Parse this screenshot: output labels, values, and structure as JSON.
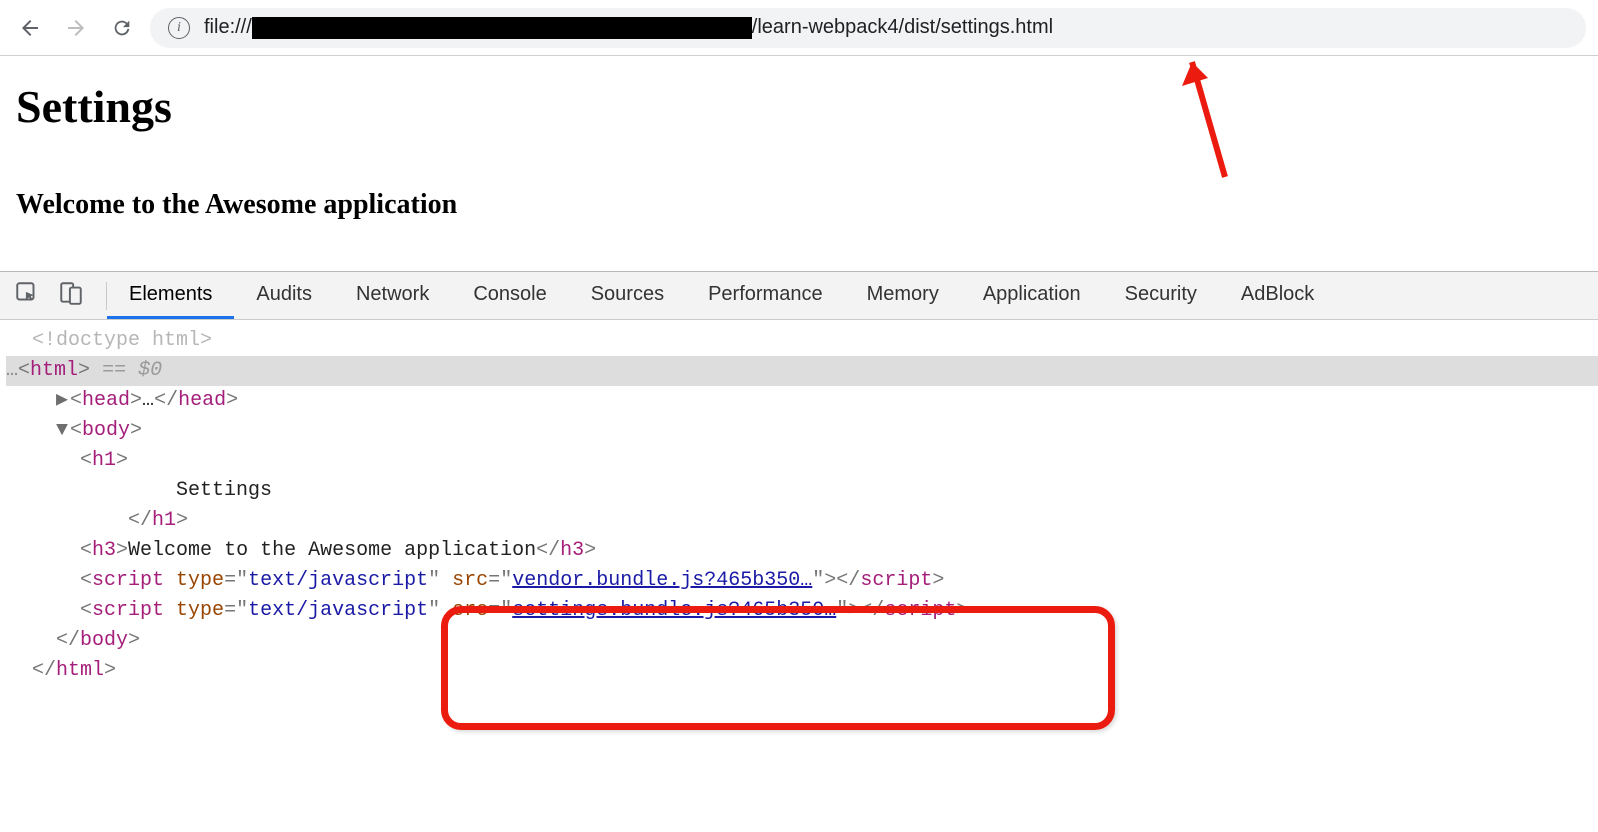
{
  "toolbar": {
    "url_prefix": "file:///",
    "url_suffix": "/learn-webpack4/dist/settings.html"
  },
  "page": {
    "heading": "Settings",
    "subheading": "Welcome to the Awesome application"
  },
  "devtools": {
    "tabs": [
      {
        "label": "Elements",
        "active": true
      },
      {
        "label": "Audits",
        "active": false
      },
      {
        "label": "Network",
        "active": false
      },
      {
        "label": "Console",
        "active": false
      },
      {
        "label": "Sources",
        "active": false
      },
      {
        "label": "Performance",
        "active": false
      },
      {
        "label": "Memory",
        "active": false
      },
      {
        "label": "Application",
        "active": false
      },
      {
        "label": "Security",
        "active": false
      },
      {
        "label": "AdBlock",
        "active": false
      }
    ],
    "dom": {
      "doctype": "<!doctype html>",
      "html_open": "html",
      "eq0": " == $0",
      "head_tag": "head",
      "head_ellipsis": "…",
      "body_tag": "body",
      "h1_tag": "h1",
      "h1_text": "Settings",
      "h3_tag": "h3",
      "h3_text": "Welcome to the Awesome application",
      "script_tag": "script",
      "attr_type": "type",
      "attr_type_val": "text/javascript",
      "attr_src": "src",
      "script1_src": "vendor.bundle.js?465b350…",
      "script2_src": "settings.bundle.js?465b350…"
    }
  }
}
